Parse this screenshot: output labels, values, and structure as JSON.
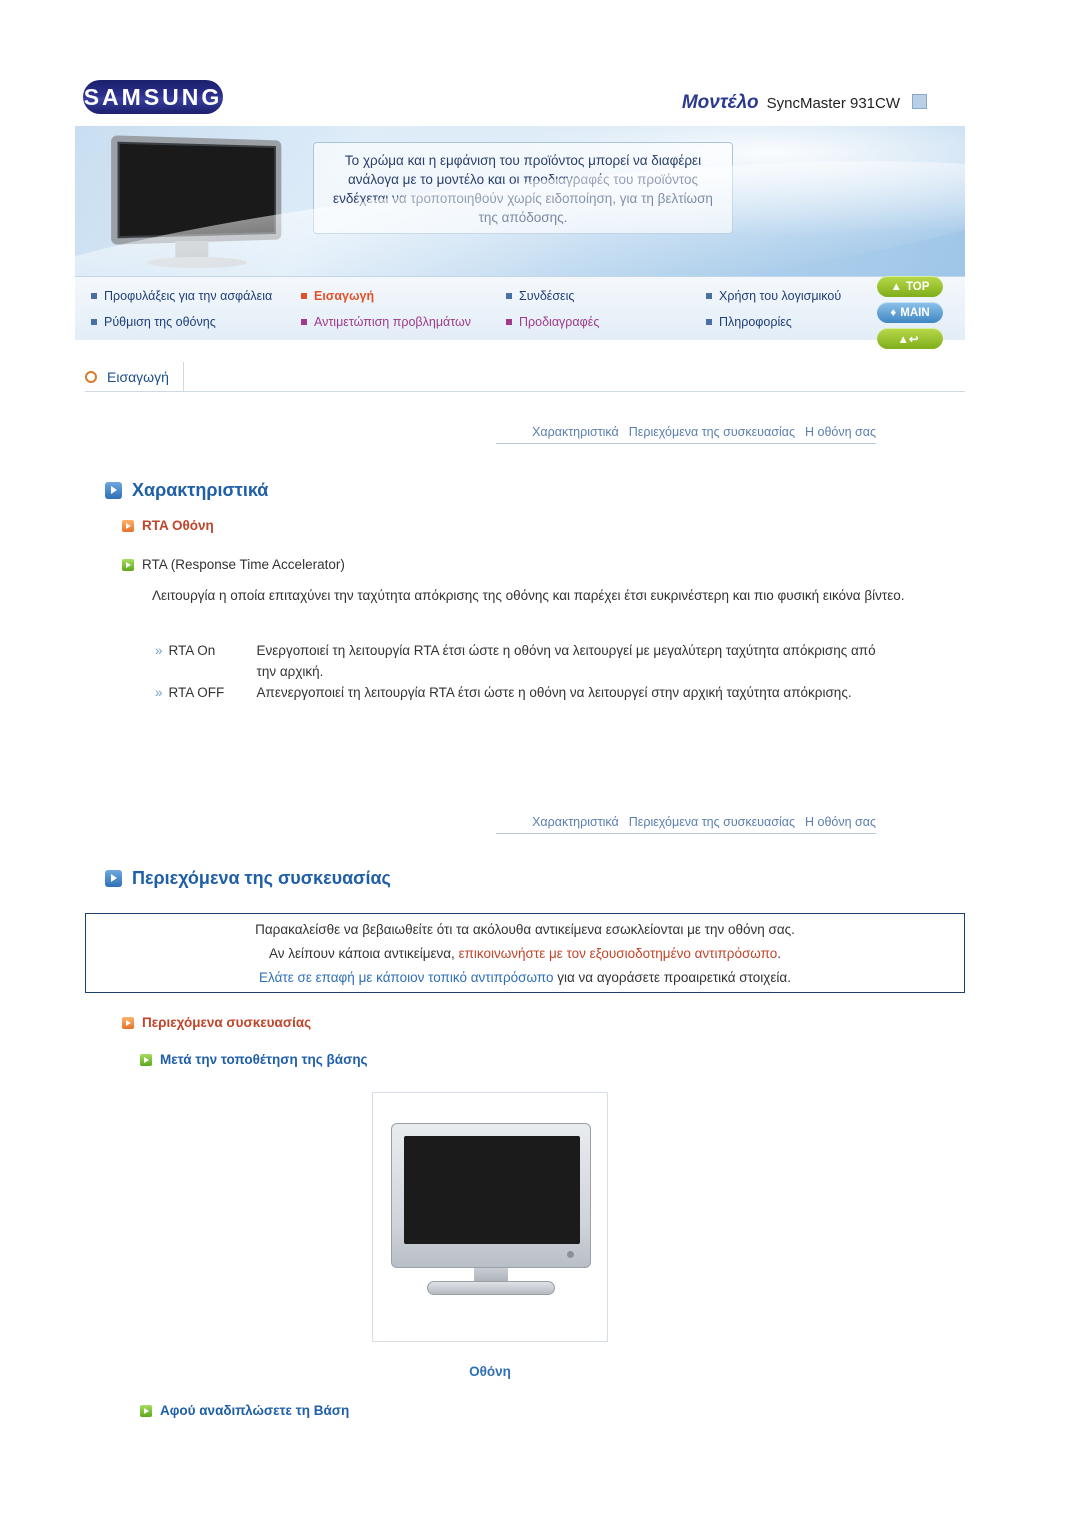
{
  "header": {
    "logo_text": "SAMSUNG",
    "model_label": "Μοντέλο",
    "model_value": "SyncMaster 931CW",
    "hero_note": "Το χρώμα και η εμφάνιση του προϊόντος μπορεί να διαφέρει ανάλογα με το μοντέλο και οι προδιαγραφές του προϊόντος ενδέχεται να τροποποιηθούν χωρίς ειδοποίηση, για τη βελτίωση της απόδοσης."
  },
  "nav": {
    "row1": [
      {
        "label": "Προφυλάξεις για την ασφάλεια",
        "style": "normal"
      },
      {
        "label": "Εισαγωγή",
        "style": "highlight"
      },
      {
        "label": "Συνδέσεις",
        "style": "normal"
      },
      {
        "label": "Χρήση του λογισμικού",
        "style": "normal"
      }
    ],
    "row2": [
      {
        "label": "Ρύθμιση της οθόνης",
        "style": "normal"
      },
      {
        "label": "Αντιμετώπιση προβλημάτων",
        "style": "magenta"
      },
      {
        "label": "Προδιαγραφές",
        "style": "magenta"
      },
      {
        "label": "Πληροφορίες",
        "style": "normal"
      }
    ],
    "side_buttons": [
      {
        "label": "TOP",
        "icon": "arrow-up-icon"
      },
      {
        "label": "MAIN",
        "icon": "home-icon"
      },
      {
        "label": "",
        "icon": "back-arrow-icon"
      }
    ]
  },
  "section": {
    "title": "Εισαγωγή"
  },
  "crumbs": [
    "Χαρακτηριστικά",
    "Περιεχόμενα της συσκευασίας",
    "Η οθόνη σας"
  ],
  "features": {
    "heading": "Χαρακτηριστικά",
    "sub_heading": "RTA Οθόνη",
    "sub_item": "RTA (Response Time Accelerator)",
    "paragraph": "Λειτουργία η οποία επιταχύνει την ταχύτητα απόκρισης της οθόνης και παρέχει έτσι ευκρινέστερη και πιο φυσική εικόνα βίντεο.",
    "rows": [
      {
        "key": "RTA On",
        "value": "Ενεργοποιεί τη λειτουργία RTA έτσι ώστε η οθόνη να λειτουργεί με μεγαλύτερη ταχύτητα απόκρισης από την αρχική."
      },
      {
        "key": "RTA OFF",
        "value": "Απενεργοποιεί τη λειτουργία RTA έτσι ώστε η οθόνη να λειτουργεί στην αρχική ταχύτητα απόκρισης."
      }
    ]
  },
  "package": {
    "heading": "Περιεχόμενα της συσκευασίας",
    "notice_line1": "Παρακαλείσθε να βεβαιωθείτε ότι τα ακόλουθα αντικείμενα εσωκλείονται με την οθόνη σας.",
    "notice_line2_a": "Αν λείπουν κάποια αντικείμενα, ",
    "notice_line2_link": "επικοινωνήστε με τον εξουσιοδοτημένο αντιπρόσωπο",
    "notice_line2_b": ".",
    "notice_line3_link": "Ελάτε σε επαφή με κάποιον τοπικό αντιπρόσωπο",
    "notice_line3_b": " για να αγοράσετε προαιρετικά στοιχεία.",
    "sub_heading": "Περιεχόμενα συσκευασίας",
    "sub_sub_heading": "Μετά την τοποθέτηση της βάσης",
    "figure_caption": "Οθόνη",
    "footer_heading": "Αφού αναδιπλώσετε τη Βάση"
  }
}
